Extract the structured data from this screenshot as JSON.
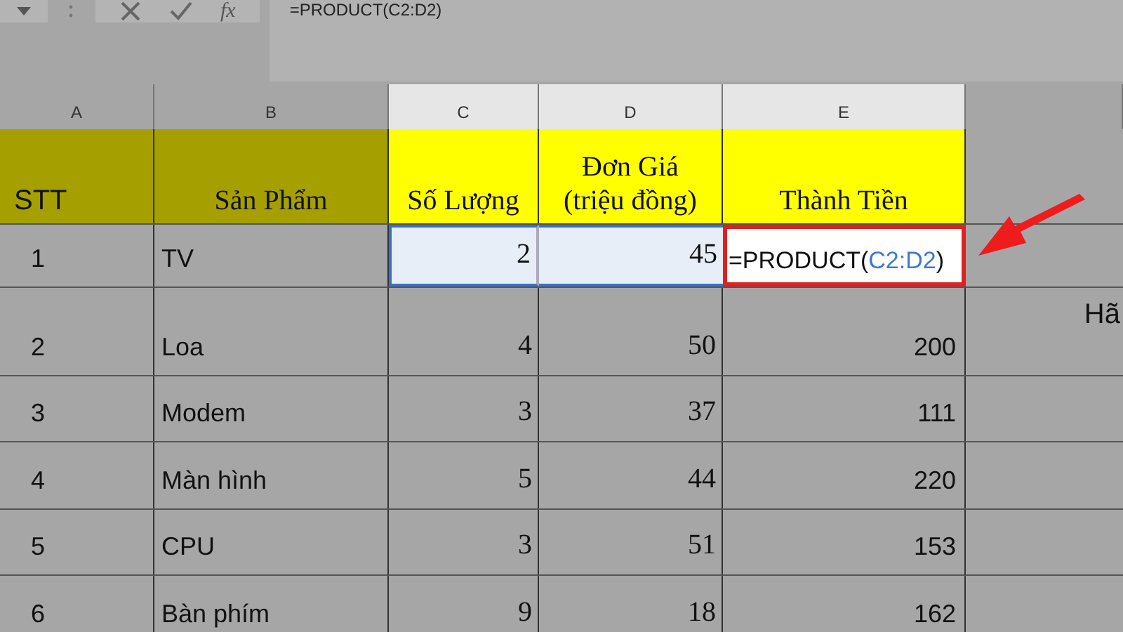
{
  "formula_bar": {
    "formula": "=PRODUCT(C2:D2)",
    "buttons": [
      {
        "kind": "cancel"
      },
      {
        "kind": "enter"
      },
      {
        "kind": "function",
        "label": "fx"
      }
    ]
  },
  "columns": [
    {
      "label": "A",
      "highlighted": false
    },
    {
      "label": "B",
      "highlighted": false
    },
    {
      "label": "C",
      "highlighted": true
    },
    {
      "label": "D",
      "highlighted": true
    },
    {
      "label": "E",
      "highlighted": true
    },
    {
      "highlighted": false
    }
  ],
  "header_row": [
    {
      "text": "STT",
      "color": "#a5a000"
    },
    {
      "text": "Sản Phẩm",
      "color": "#a5a000"
    },
    {
      "text": "Số Lượng",
      "color": "#ffff00"
    },
    {
      "text": "Đơn Giá\n(triệu đồng)",
      "color": "#ffff00"
    },
    {
      "text": "Thành Tiền",
      "color": "#ffff00"
    }
  ],
  "rows": [
    {
      "stt": "1",
      "product": "TV",
      "quantity": "2",
      "price": "45",
      "range_selected": true,
      "total": {
        "kind": "formula",
        "prefix": "=PRODUCT(",
        "reference": "C2:D2",
        "suffix": ")"
      }
    },
    {
      "stt": "2",
      "product": "Loa",
      "quantity": "4",
      "price": "50",
      "range_selected": false,
      "total": {
        "kind": "value",
        "text": "200"
      },
      "overflow_text": "Hã"
    },
    {
      "stt": "3",
      "product": "Modem",
      "quantity": "3",
      "price": "37",
      "range_selected": false,
      "total": {
        "kind": "value",
        "text": "111"
      }
    },
    {
      "stt": "4",
      "product": "Màn hình",
      "quantity": "5",
      "price": "44",
      "range_selected": false,
      "total": {
        "kind": "value",
        "text": "220"
      }
    },
    {
      "stt": "5",
      "product": "CPU",
      "quantity": "3",
      "price": "51",
      "range_selected": false,
      "total": {
        "kind": "value",
        "text": "153"
      }
    },
    {
      "stt": "6",
      "product": "Bàn phím",
      "quantity": "9",
      "price": "18",
      "range_selected": false,
      "total": {
        "kind": "value",
        "text": "162"
      }
    }
  ]
}
